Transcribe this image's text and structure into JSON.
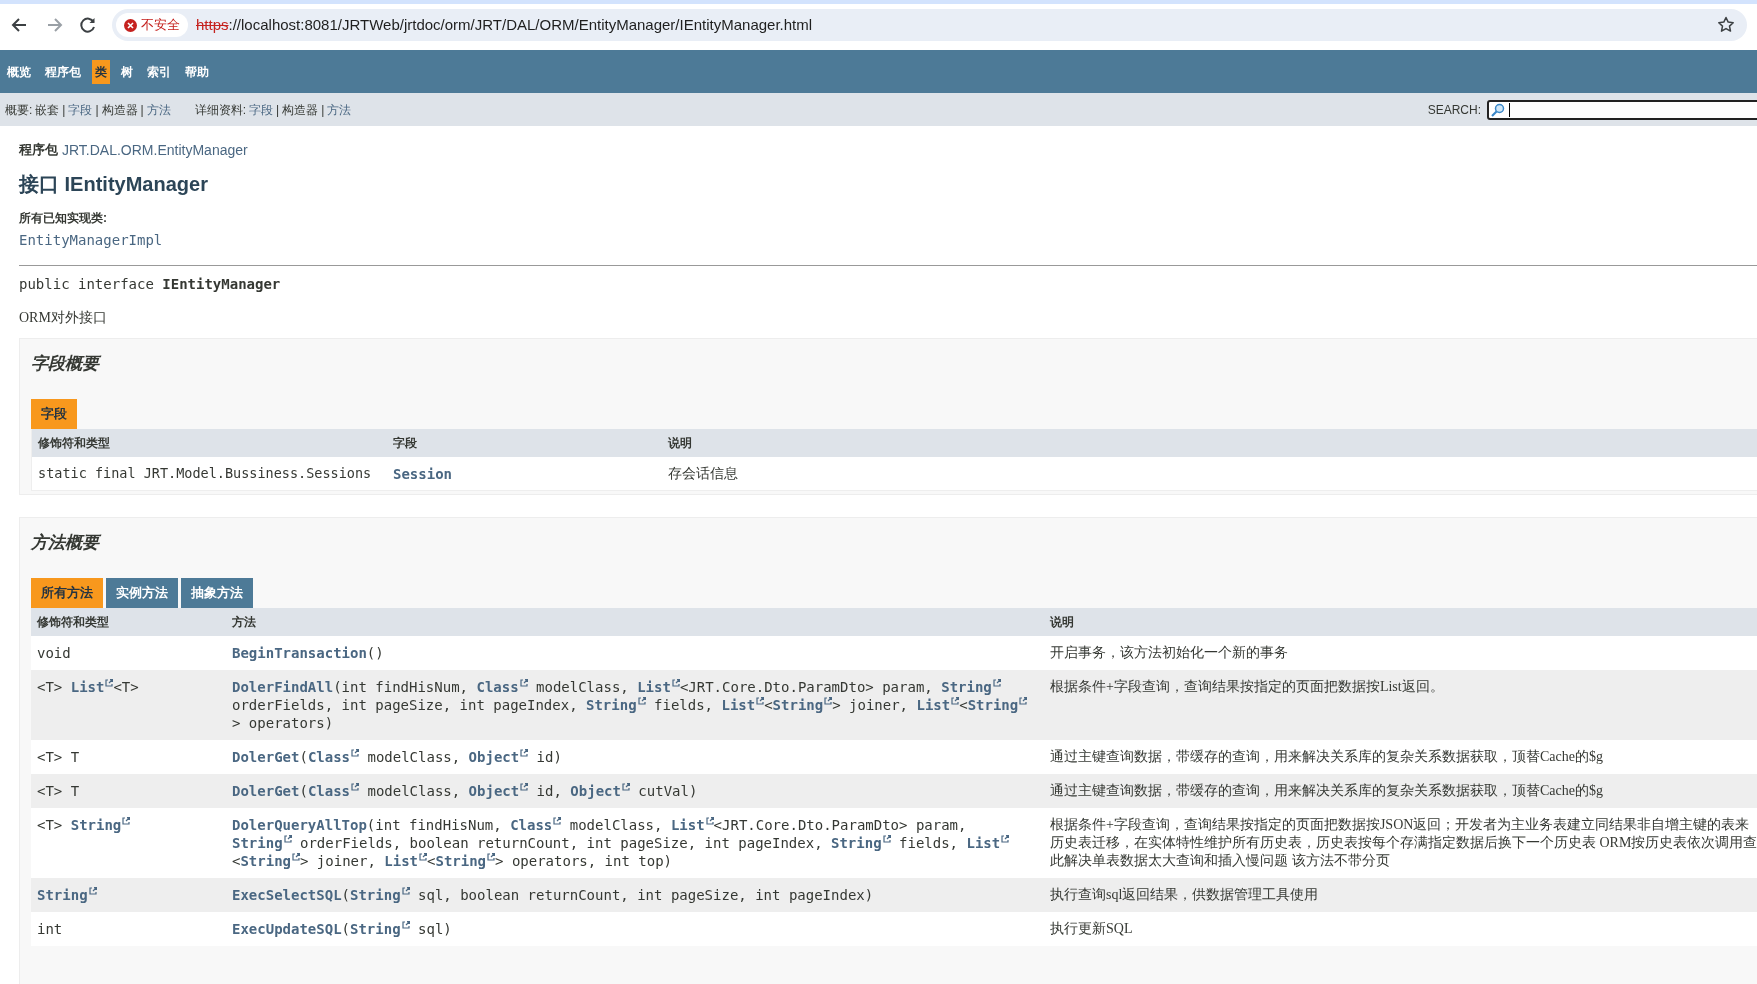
{
  "browser": {
    "security_label": "不安全",
    "url_scheme": "https",
    "url_rest": "://localhost:8081/JRTWeb/jrtdoc/orm/JRT/DAL/ORM/EntityManager/IEntityManager.html"
  },
  "nav": {
    "items": [
      {
        "label": "概览",
        "selected": false
      },
      {
        "label": "程序包",
        "selected": false
      },
      {
        "label": "类",
        "selected": true
      },
      {
        "label": "树",
        "selected": false
      },
      {
        "label": "索引",
        "selected": false
      },
      {
        "label": "帮助",
        "selected": false
      }
    ]
  },
  "subnav": {
    "separator": "|",
    "groups": [
      {
        "label": "概要:",
        "items": [
          {
            "label": "嵌套",
            "link": false
          },
          {
            "label": "字段",
            "link": true
          },
          {
            "label": "构造器",
            "link": false
          },
          {
            "label": "方法",
            "link": true
          }
        ]
      },
      {
        "label": "详细资料:",
        "items": [
          {
            "label": "字段",
            "link": true
          },
          {
            "label": "构造器",
            "link": false
          },
          {
            "label": "方法",
            "link": true
          }
        ]
      }
    ],
    "search_label": "SEARCH:"
  },
  "header": {
    "package_label": "程序包",
    "package": "JRT.DAL.ORM.EntityManager",
    "title": "接口 IEntityManager",
    "implementations_label": "所有已知实现类:",
    "implementations": [
      "EntityManagerImpl"
    ],
    "signature_prefix": "public interface ",
    "signature_name": "IEntityManager",
    "description": "ORM对外接口"
  },
  "field_summary": {
    "heading": "字段概要",
    "tabs": [
      {
        "label": "字段",
        "selected": true
      }
    ],
    "columns": [
      "修饰符和类型",
      "字段",
      "说明"
    ],
    "rows": [
      {
        "type": [
          "static final JRT.Model.Bussiness.Sessions"
        ],
        "field": "Session",
        "description": "存会话信息"
      }
    ]
  },
  "method_summary": {
    "heading": "方法概要",
    "tabs": [
      {
        "label": "所有方法",
        "selected": true
      },
      {
        "label": "实例方法",
        "selected": false
      },
      {
        "label": "抽象方法",
        "selected": false
      }
    ],
    "columns": [
      "修饰符和类型",
      "方法",
      "说明"
    ],
    "rows": [
      {
        "type": [
          "void"
        ],
        "method": [
          {
            "text": "BeginTransaction",
            "kind": "link"
          },
          "()"
        ],
        "description": [
          "开启事务，该方法初始化一个新的事务"
        ]
      },
      {
        "type": [
          "<T> ",
          {
            "text": "List",
            "kind": "ext"
          },
          "<T>"
        ],
        "method": [
          {
            "text": "DolerFindAll",
            "kind": "link"
          },
          "(int findHisNum, ",
          {
            "text": "Class",
            "kind": "ext"
          },
          " modelClass, ",
          {
            "text": "List",
            "kind": "ext"
          },
          "<JRT.Core.Dto.ParamDto> param, ",
          {
            "text": "String",
            "kind": "ext"
          },
          " orderFields, int pageSize, int pageIndex, ",
          {
            "text": "String",
            "kind": "ext"
          },
          " fields, ",
          {
            "text": "List",
            "kind": "ext"
          },
          "<",
          {
            "text": "String",
            "kind": "ext"
          },
          "> joiner, ",
          {
            "text": "List",
            "kind": "ext"
          },
          "<",
          {
            "text": "String",
            "kind": "ext"
          },
          "> operators)"
        ],
        "description": [
          "根据条件+字段查询，查询结果按指定的页面把数据按List返回。"
        ]
      },
      {
        "type": [
          "<T> T"
        ],
        "method": [
          {
            "text": "DolerGet",
            "kind": "link"
          },
          "(",
          {
            "text": "Class",
            "kind": "ext"
          },
          " modelClass, ",
          {
            "text": "Object",
            "kind": "ext"
          },
          " id)"
        ],
        "description": [
          "通过主键查询数据，带缓存的查询，用来解决关系库的复杂关系数据获取，顶替Cache的$g"
        ]
      },
      {
        "type": [
          "<T> T"
        ],
        "method": [
          {
            "text": "DolerGet",
            "kind": "link"
          },
          "(",
          {
            "text": "Class",
            "kind": "ext"
          },
          " modelClass, ",
          {
            "text": "Object",
            "kind": "ext"
          },
          " id, ",
          {
            "text": "Object",
            "kind": "ext"
          },
          " cutVal)"
        ],
        "description": [
          "通过主键查询数据，带缓存的查询，用来解决关系库的复杂关系数据获取，顶替Cache的$g"
        ]
      },
      {
        "type": [
          "<T> ",
          {
            "text": "String",
            "kind": "ext"
          }
        ],
        "method": [
          {
            "text": "DolerQueryAllTop",
            "kind": "link"
          },
          "(int findHisNum, ",
          {
            "text": "Class",
            "kind": "ext"
          },
          " modelClass, ",
          {
            "text": "List",
            "kind": "ext"
          },
          "<JRT.Core.Dto.ParamDto> param, ",
          {
            "text": "String",
            "kind": "ext"
          },
          " orderFields, boolean returnCount, int pageSize, int pageIndex, ",
          {
            "text": "String",
            "kind": "ext"
          },
          " fields, ",
          {
            "text": "List",
            "kind": "ext"
          },
          "<",
          {
            "text": "String",
            "kind": "ext"
          },
          "> joiner, ",
          {
            "text": "List",
            "kind": "ext"
          },
          "<",
          {
            "text": "String",
            "kind": "ext"
          },
          "> operators, int top)"
        ],
        "description": [
          "根据条件+字段查询，查询结果按指定的页面把数据按JSON返回；开发者为主业务表建立同结果非自增主键的表来",
          "历史表迁移，在实体特性维护所有历史表，历史表按每个存满指定数据后换下一个历史表 ORM按历史表依次调用查",
          "此解决单表数据太大查询和插入慢问题 该方法不带分页"
        ]
      },
      {
        "type": [
          {
            "text": "String",
            "kind": "ext"
          }
        ],
        "method": [
          {
            "text": "ExecSelectSQL",
            "kind": "link"
          },
          "(",
          {
            "text": "String",
            "kind": "ext"
          },
          " sql, boolean returnCount, int pageSize, int pageIndex)"
        ],
        "description": [
          "执行查询sql返回结果，供数据管理工具使用"
        ]
      },
      {
        "type": [
          "int"
        ],
        "method": [
          {
            "text": "ExecUpdateSQL",
            "kind": "link"
          },
          "(",
          {
            "text": "String",
            "kind": "ext"
          },
          " sql)"
        ],
        "description": [
          "执行更新SQL"
        ]
      }
    ]
  }
}
